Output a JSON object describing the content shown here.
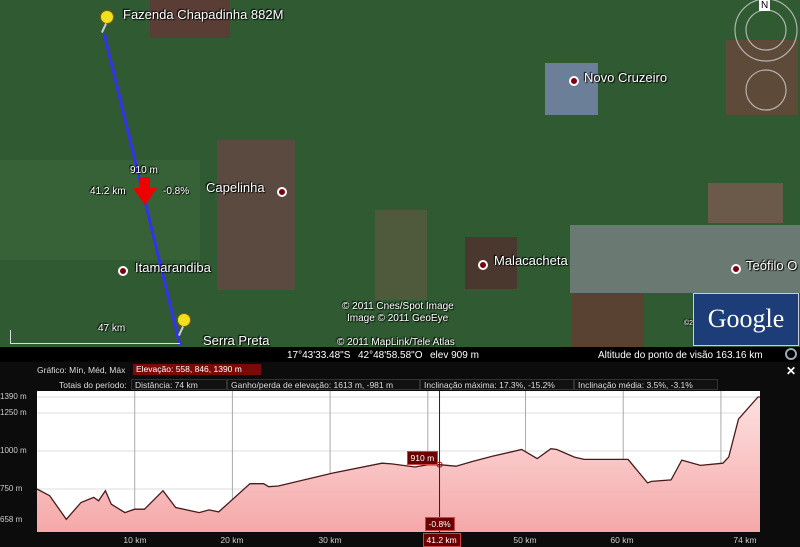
{
  "map": {
    "places": {
      "fazenda": "Fazenda Chapadinha 882M",
      "capelinha": "Capelinha",
      "itamarandiba": "Itamarandiba",
      "serra_preta": "Serra Preta",
      "novo_cruzeiro": "Novo Cruzeiro",
      "malacacheta": "Malacacheta",
      "teofilo": "Teófilo O"
    },
    "path_marker": {
      "elevation": "910 m",
      "distance": "41.2 km",
      "slope": "-0.8%"
    },
    "scale_label": "47 km",
    "credits": [
      "© 2011 Cnes/Spot Image",
      "Image © 2011 GeoEye",
      "© 2011 MapLink/Tele Atlas"
    ],
    "google_logo": "Google",
    "logo_copyright": "©2010",
    "compass_letter": "N"
  },
  "status": {
    "lat": "17°43'33.48\"S",
    "lon": "42°48'58.58\"O",
    "elev": "elev  909 m",
    "eye_alt": "Altitude do ponto de visão   163.16 km"
  },
  "panel": {
    "graph_label": "Gráfico: Mín, Méd, Máx",
    "elevation_summary": "Elevação: 558, 846, 1390 m",
    "totals_label": "Totais do período:",
    "distance": "Distância: 74 km",
    "gain_loss": "Ganho/perda de elevação: 1613 m, -981 m",
    "max_slope": "Inclinação máxima: 17.3%, -15.2%",
    "avg_slope": "Inclinação média: 3.5%, -3.1%",
    "close": "✕"
  },
  "chart_data": {
    "type": "area",
    "xlabel": "",
    "ylabel": "",
    "xlim": [
      0,
      74
    ],
    "y_ticks": [
      "1390 m",
      "1250 m",
      "1000 m",
      "750 m",
      "658 m"
    ],
    "x_ticks": [
      "10 km",
      "20 km",
      "30 km",
      "40 km",
      "50 km",
      "60 km",
      "74 km"
    ],
    "cursor": {
      "distance_km": 41.2,
      "distance_label": "41.2 km",
      "elevation_label": "910 m",
      "slope_label": "-0.8%"
    },
    "series": [
      {
        "name": "Elevação",
        "x": [
          0,
          1.3,
          3,
          4.5,
          5.8,
          6.3,
          7,
          7.6,
          9,
          10,
          11,
          12.9,
          14.2,
          16.6,
          17.6,
          18.6,
          21.8,
          23.2,
          23.7,
          24.7,
          30.3,
          35.3,
          36.3,
          38.7,
          40,
          41.2,
          42.9,
          44.5,
          46.6,
          49.6,
          51.2,
          52.6,
          53.2,
          55,
          56,
          60.5,
          62.5,
          62.9,
          64.9,
          66,
          67.9,
          70.2,
          70.8,
          71.8,
          73.8,
          74
        ],
        "y": [
          750,
          730,
          660,
          710,
          725,
          715,
          745,
          705,
          680,
          690,
          690,
          745,
          695,
          680,
          688,
          682,
          785,
          785,
          765,
          770,
          855,
          920,
          915,
          895,
          910,
          910,
          900,
          930,
          965,
          1010,
          950,
          1015,
          1010,
          960,
          945,
          945,
          790,
          800,
          810,
          940,
          905,
          920,
          960,
          1210,
          1390,
          1390
        ]
      }
    ]
  }
}
